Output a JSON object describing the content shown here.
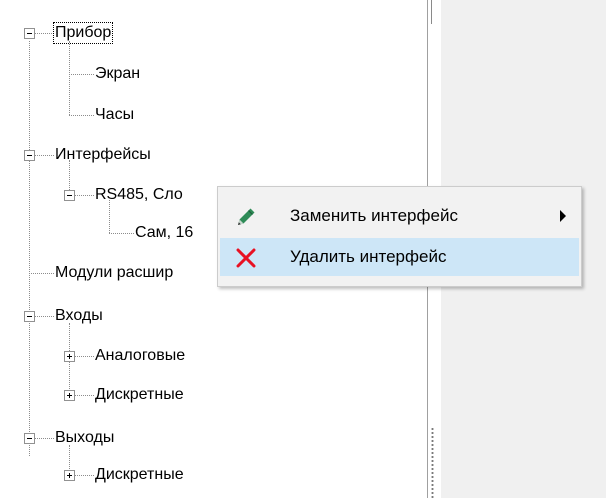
{
  "tree": {
    "nodes": [
      {
        "id": "pribor",
        "label": "Прибор"
      },
      {
        "id": "ekran",
        "label": "Экран"
      },
      {
        "id": "chasy",
        "label": "Часы"
      },
      {
        "id": "interfeisy",
        "label": "Интерфейсы"
      },
      {
        "id": "rs485",
        "label": "RS485, Сло"
      },
      {
        "id": "sam",
        "label": "Сам, 16"
      },
      {
        "id": "moduli",
        "label": "Модули расшир"
      },
      {
        "id": "vkhody",
        "label": "Входы"
      },
      {
        "id": "analog",
        "label": "Аналоговые"
      },
      {
        "id": "diskr_in",
        "label": "Дискретные"
      },
      {
        "id": "vykhody",
        "label": "Выходы"
      },
      {
        "id": "diskr_out",
        "label": "Дискретные"
      }
    ]
  },
  "context_menu": {
    "items": [
      {
        "label": "Заменить интерфейс",
        "icon": "pencil-icon",
        "has_submenu": true
      },
      {
        "label": "Удалить интерфейс",
        "icon": "delete-x-icon",
        "highlighted": true
      }
    ]
  },
  "colors": {
    "menu_bg": "#f2f2f2",
    "menu_highlight": "#cde6f7",
    "right_panel_bg": "#f0f0f0",
    "delete_red": "#e81123",
    "pencil_green": "#2e8b57"
  }
}
